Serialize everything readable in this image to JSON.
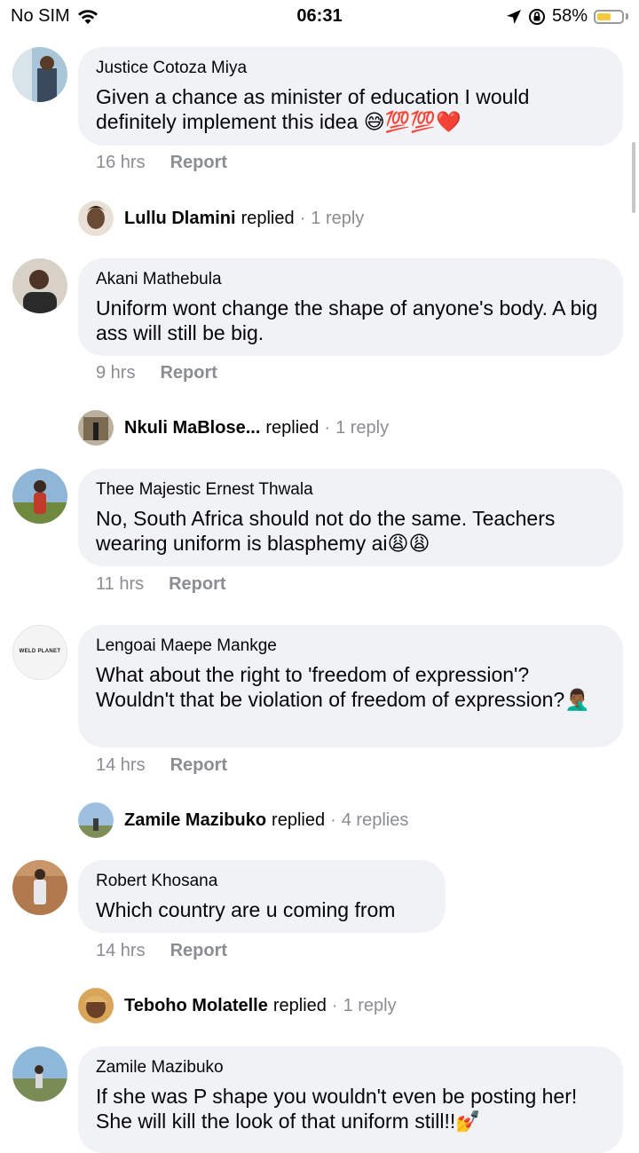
{
  "status_bar": {
    "carrier": "No SIM",
    "time": "06:31",
    "battery": "58%",
    "battery_level": 0.58
  },
  "comments": [
    {
      "author": "Justice Cotoza Miya",
      "text": "Given a chance as minister of education I would definitely implement this idea 😅💯💯❤️",
      "time": "16 hrs",
      "report": "Report",
      "reply": {
        "name": "Lullu Dlamini",
        "verb": "replied",
        "dot": "·",
        "count": "1 reply"
      }
    },
    {
      "author": "Akani Mathebula",
      "text": "Uniform wont change the shape of anyone's body. A big ass will still be big.",
      "time": "9 hrs",
      "report": "Report",
      "reply": {
        "name": "Nkuli MaBlose...",
        "verb": "replied",
        "dot": "·",
        "count": "1 reply"
      }
    },
    {
      "author": "Thee Majestic Ernest Thwala",
      "text": "No, South Africa should not do the same. Teachers wearing uniform is blasphemy ai😩😩",
      "time": "11 hrs",
      "report": "Report"
    },
    {
      "author": "Lengoai Maepe Mankge",
      "avatar_text": "WELD PLANET",
      "text": "What about the right to 'freedom of expression'? Wouldn't that be violation of freedom of expression?🤦🏾‍♂️",
      "time": "14 hrs",
      "report": "Report",
      "reply": {
        "name": "Zamile Mazibuko",
        "verb": "replied",
        "dot": "·",
        "count": "4 replies"
      }
    },
    {
      "author": "Robert Khosana",
      "text": "Which country are u coming from",
      "time": "14 hrs",
      "report": "Report",
      "reply": {
        "name": "Teboho Molatelle",
        "verb": "replied",
        "dot": "·",
        "count": "1 reply"
      }
    },
    {
      "author": "Zamile Mazibuko",
      "text": "If she was P shape you wouldn't even be posting her! She will kill the look of that uniform still!!💅"
    }
  ],
  "colors": {
    "bubble": "#f0f2f5",
    "meta": "#8a8d91",
    "text": "#050505",
    "battery": "#f6c93a"
  }
}
